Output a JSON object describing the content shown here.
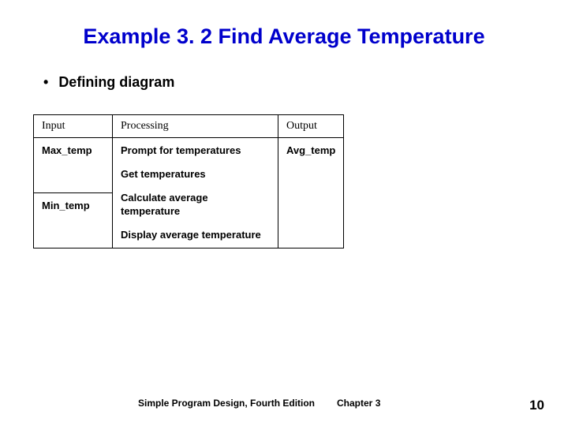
{
  "title": "Example 3. 2 Find Average Temperature",
  "bullet": "Defining diagram",
  "table": {
    "headers": {
      "input": "Input",
      "processing": "Processing",
      "output": "Output"
    },
    "input_rows": [
      "Max_temp",
      "Min_temp"
    ],
    "processing_rows": [
      "Prompt for temperatures",
      "Get temperatures",
      "Calculate average temperature",
      "Display average temperature"
    ],
    "output": "Avg_temp"
  },
  "footer": {
    "book": "Simple Program Design, Fourth Edition",
    "chapter": "Chapter 3",
    "page": "10"
  }
}
